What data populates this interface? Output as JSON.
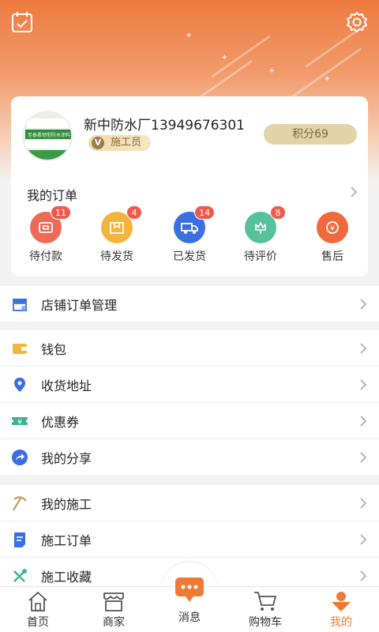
{
  "user": {
    "name": "新中防水厂13949676301",
    "role": "施工员",
    "role_mark": "V",
    "points": "积分69",
    "avatar_text": "至泰柔韧型防水涂料"
  },
  "orders": {
    "title": "我的订单",
    "items": [
      {
        "label": "待付款",
        "badge": "11",
        "color": "#ee6a55"
      },
      {
        "label": "待发货",
        "badge": "4",
        "color": "#f3b43d"
      },
      {
        "label": "已发货",
        "badge": "14",
        "color": "#3a6fe0"
      },
      {
        "label": "待评价",
        "badge": "8",
        "color": "#56c29a"
      },
      {
        "label": "售后",
        "badge": "",
        "color": "#ee6a3d"
      }
    ]
  },
  "menu": {
    "store_orders": "店铺订单管理",
    "wallet": "钱包",
    "address": "收货地址",
    "coupon": "优惠券",
    "share": "我的分享",
    "construction": "我的施工",
    "construction_orders": "施工订单",
    "construction_favorites": "施工收藏"
  },
  "tabs": [
    {
      "label": "首页"
    },
    {
      "label": "商家"
    },
    {
      "label": "消息"
    },
    {
      "label": "购物车"
    },
    {
      "label": "我的",
      "active": true
    }
  ],
  "colors": {
    "accent": "#ef7a36",
    "badge": "#ef5a4d"
  }
}
